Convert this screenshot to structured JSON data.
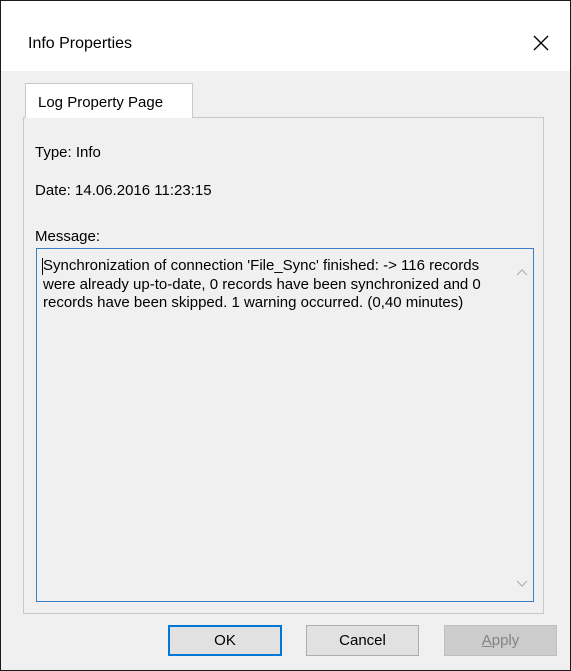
{
  "window": {
    "title": "Info Properties"
  },
  "tabs": [
    {
      "label": "Log Property Page",
      "active": true
    }
  ],
  "fields": {
    "type": "Type: Info",
    "date": "Date: 14.06.2016 11:23:15",
    "message_label": "Message:"
  },
  "message": {
    "text": "Synchronization of connection 'File_Sync' finished: -> 116 records were already up-to-date, 0 records have been synchronized and 0 records have been skipped. 1 warning occurred. (0,40 minutes)"
  },
  "buttons": {
    "ok": "OK",
    "cancel": "Cancel",
    "apply_first": "A",
    "apply_rest": "pply"
  },
  "icons": {
    "close": "close-icon",
    "scroll_up": "chevron-up-icon",
    "scroll_down": "chevron-down-icon"
  },
  "colors": {
    "accent": "#0078d7",
    "focus_border": "#3c7fc8",
    "disabled_text": "#838383"
  }
}
